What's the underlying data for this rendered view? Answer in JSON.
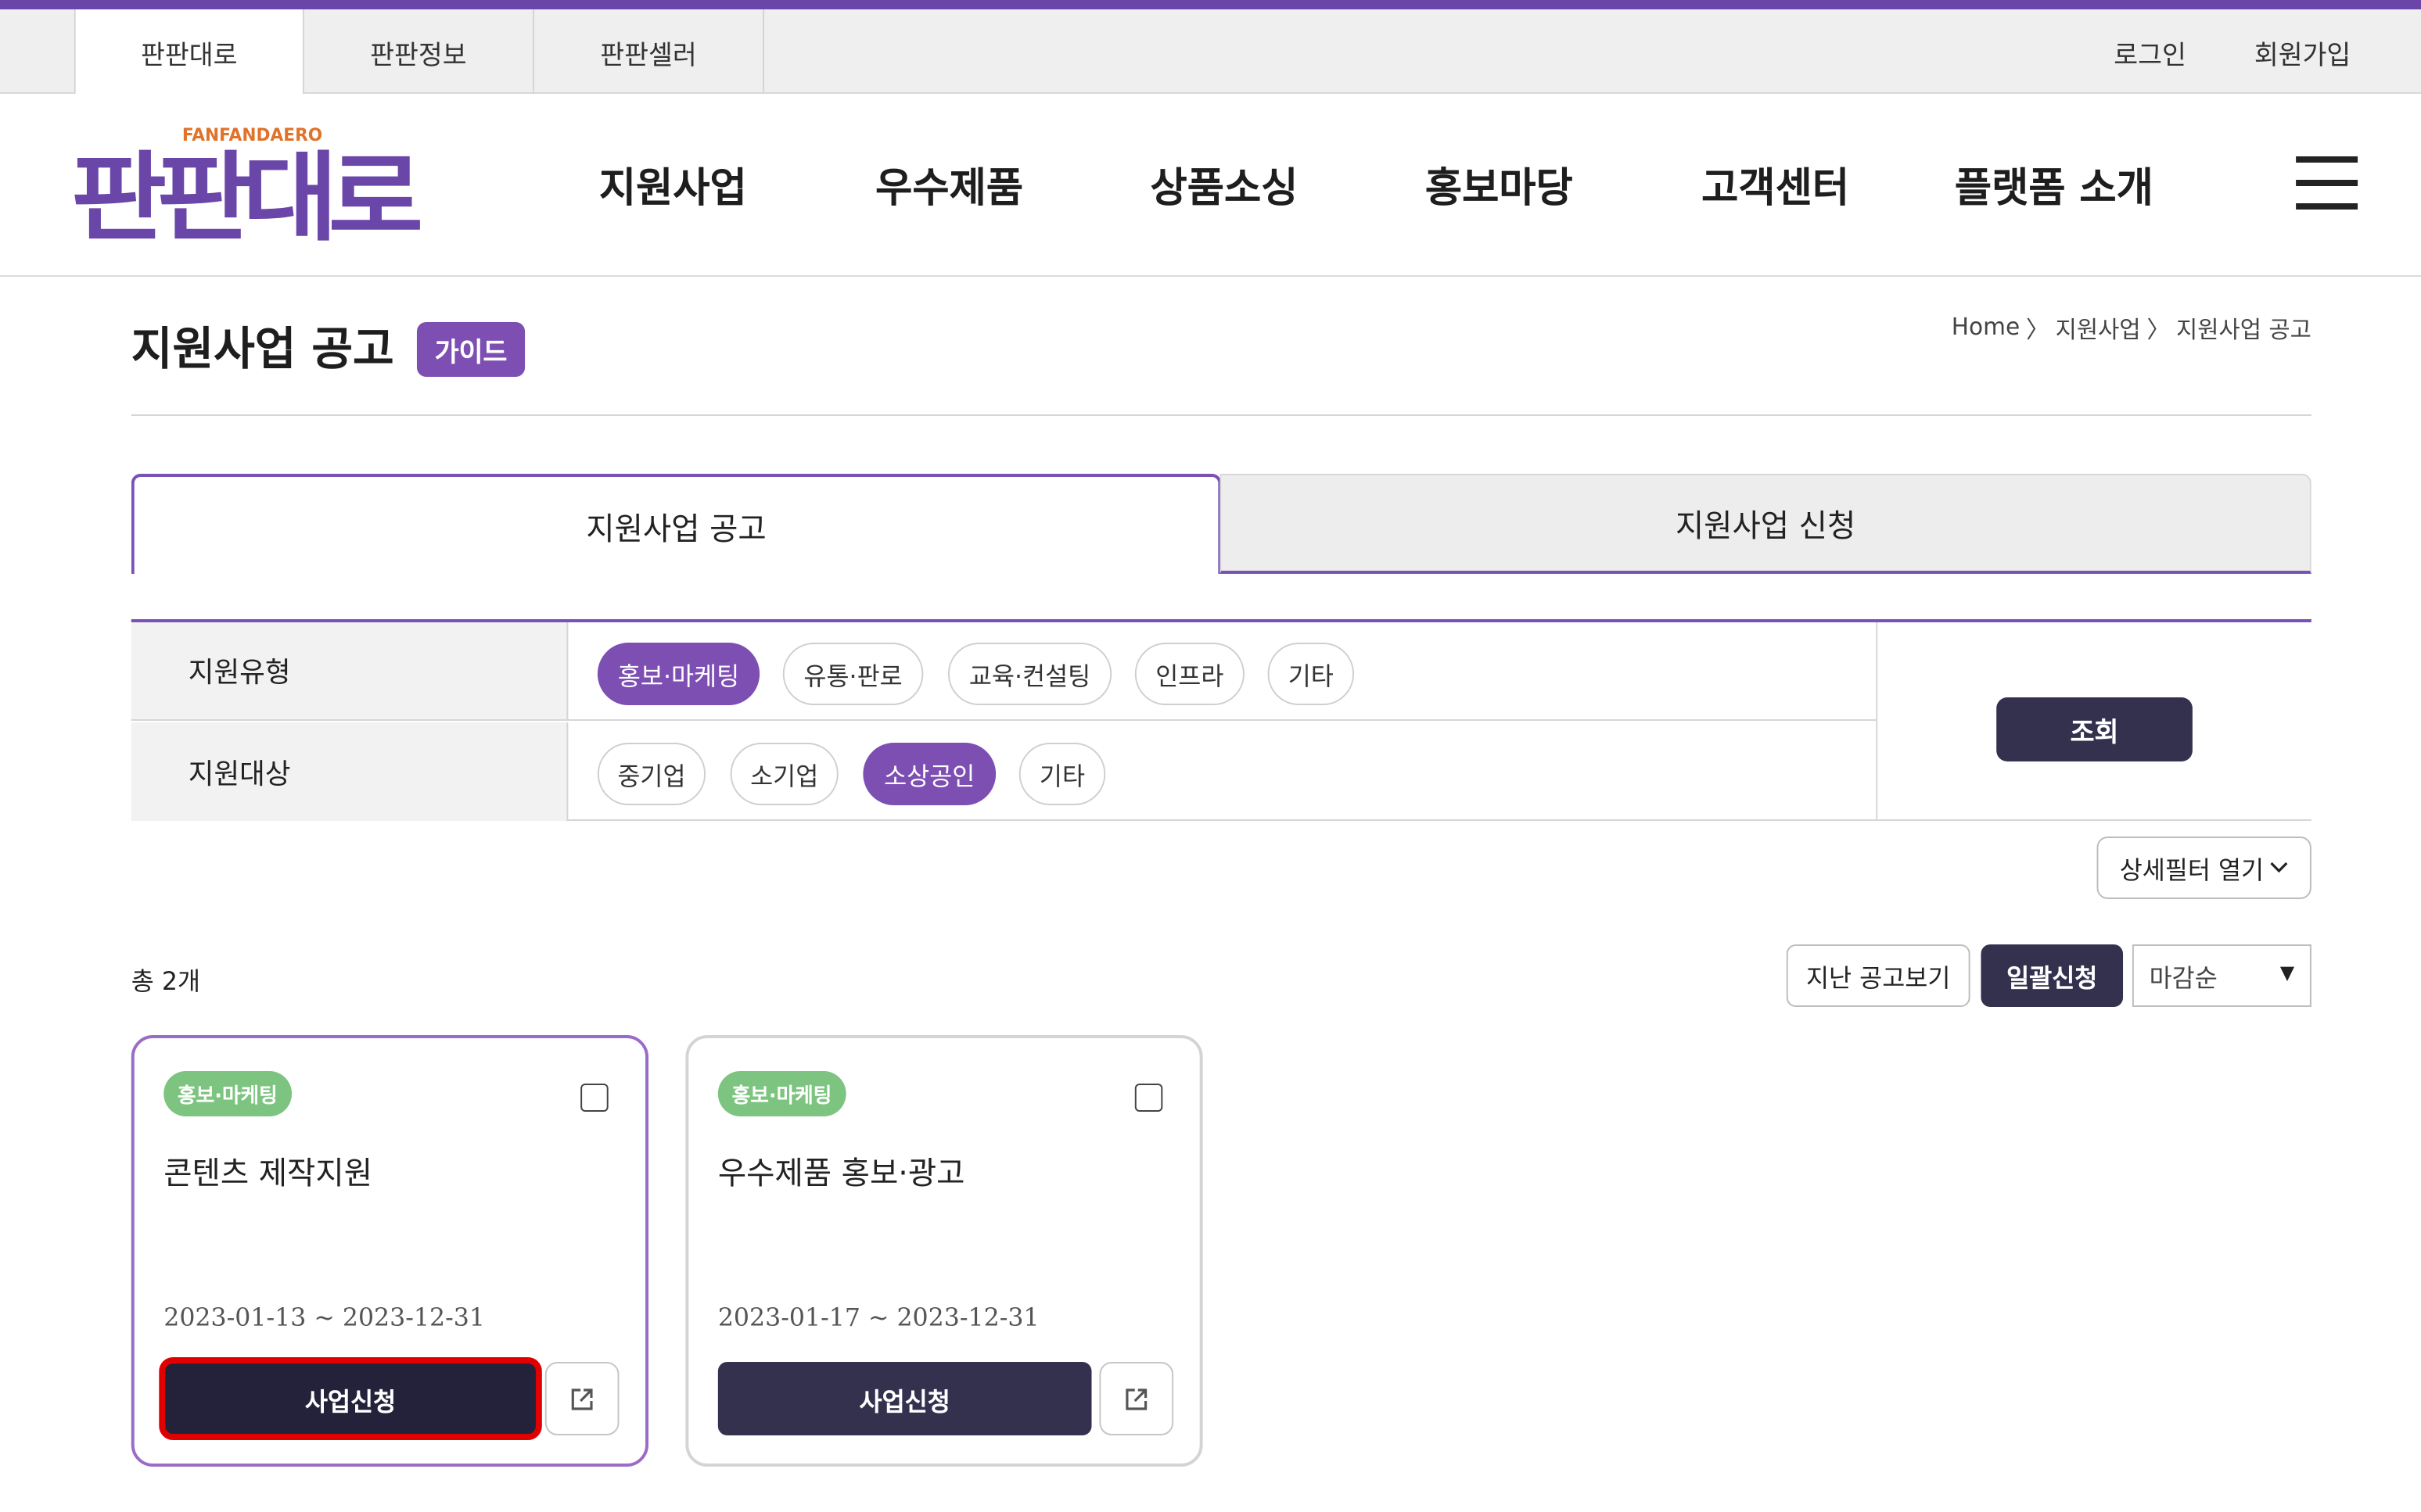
{
  "utility_bar": {
    "site_tabs": [
      {
        "label": "판판대로",
        "active": true
      },
      {
        "label": "판판정보",
        "active": false
      },
      {
        "label": "판판셀러",
        "active": false
      }
    ],
    "login": "로그인",
    "signup": "회원가입"
  },
  "header": {
    "logo_text": "판판대로",
    "logo_subtext": "FANFANDAERO",
    "brand_color": "#6a46a8",
    "nav": [
      "지원사업",
      "우수제품",
      "상품소싱",
      "홍보마당",
      "고객센터",
      "플랫폼 소개"
    ]
  },
  "page": {
    "title": "지원사업 공고",
    "guide_label": "가이드",
    "breadcrumb": [
      "Home",
      "지원사업",
      "지원사업 공고"
    ],
    "breadcrumb_separator": "〉"
  },
  "tabs": [
    {
      "label": "지원사업 공고",
      "active": true
    },
    {
      "label": "지원사업 신청",
      "active": false
    }
  ],
  "filters": {
    "type": {
      "label": "지원유형",
      "options": [
        {
          "label": "홍보·마케팅",
          "selected": true
        },
        {
          "label": "유통·판로",
          "selected": false
        },
        {
          "label": "교육·컨설팅",
          "selected": false
        },
        {
          "label": "인프라",
          "selected": false
        },
        {
          "label": "기타",
          "selected": false
        }
      ]
    },
    "target": {
      "label": "지원대상",
      "options": [
        {
          "label": "중기업",
          "selected": false
        },
        {
          "label": "소기업",
          "selected": false
        },
        {
          "label": "소상공인",
          "selected": true
        },
        {
          "label": "기타",
          "selected": false
        }
      ]
    },
    "search_label": "조회",
    "detail_filter_label": "상세필터 열기"
  },
  "list": {
    "total_text": "총 2개",
    "past_label": "지난 공고보기",
    "bulk_apply_label": "일괄신청",
    "sort_selected": "마감순"
  },
  "cards": [
    {
      "category": "홍보·마케팅",
      "title": "콘텐츠 제작지원",
      "period": "2023-01-13 ~ 2023-12-31",
      "apply_label": "사업신청",
      "highlighted": true
    },
    {
      "category": "홍보·마케팅",
      "title": "우수제품 홍보·광고",
      "period": "2023-01-17 ~ 2023-12-31",
      "apply_label": "사업신청",
      "highlighted": false
    }
  ],
  "colors": {
    "accent_purple": "#7d4fb3",
    "dark_navy": "#34314f",
    "category_green": "#7cc47f",
    "highlight_red": "#e00000"
  }
}
